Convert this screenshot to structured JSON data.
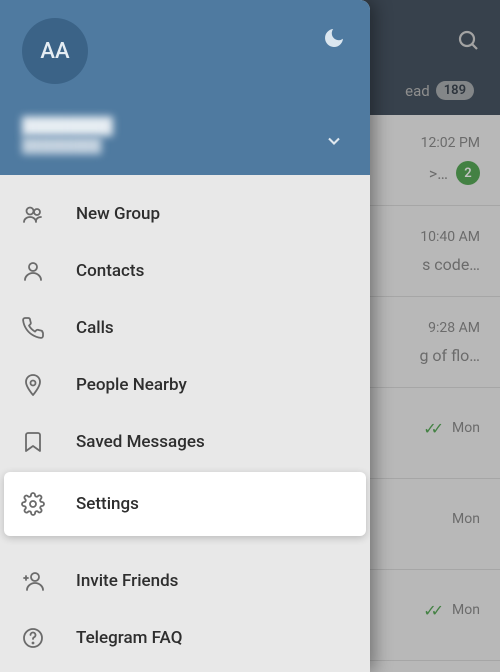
{
  "background": {
    "unread_tab_label": "ead",
    "unread_count": "189",
    "chats": [
      {
        "time": "12:02 PM",
        "preview": ">…",
        "badge": "2",
        "checks": false
      },
      {
        "time": "10:40 AM",
        "preview": "s code…",
        "badge": null,
        "checks": false
      },
      {
        "time": "9:28 AM",
        "preview": "g of flo…",
        "badge": null,
        "checks": false
      },
      {
        "time": "Mon",
        "preview": "",
        "badge": null,
        "checks": true
      },
      {
        "time": "Mon",
        "preview": "",
        "badge": null,
        "checks": false
      },
      {
        "time": "Mon",
        "preview": "",
        "badge": null,
        "checks": true
      }
    ]
  },
  "drawer": {
    "avatar_initials": "AA",
    "user_name": "████████",
    "user_phone": "████████",
    "menu": [
      {
        "icon": "group",
        "label": "New Group"
      },
      {
        "icon": "person",
        "label": "Contacts"
      },
      {
        "icon": "phone",
        "label": "Calls"
      },
      {
        "icon": "nearby",
        "label": "People Nearby"
      },
      {
        "icon": "bookmark",
        "label": "Saved Messages"
      },
      {
        "icon": "gear",
        "label": "Settings",
        "highlighted": true
      },
      {
        "gap": true
      },
      {
        "icon": "add-person",
        "label": "Invite Friends"
      },
      {
        "icon": "help",
        "label": "Telegram FAQ"
      }
    ]
  }
}
